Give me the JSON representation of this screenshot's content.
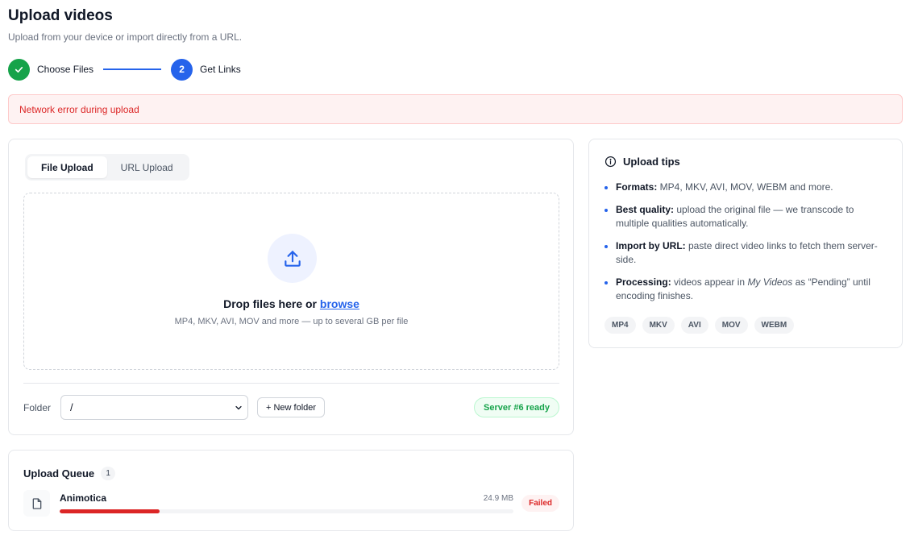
{
  "header": {
    "title": "Upload videos",
    "subtitle": "Upload from your device or import directly from a URL."
  },
  "stepper": {
    "steps": [
      {
        "label": "Choose Files",
        "state": "done",
        "icon": "check-icon"
      },
      {
        "label": "Get Links",
        "number": "2",
        "state": "active"
      }
    ]
  },
  "error": {
    "message": "Network error during upload"
  },
  "upload": {
    "tabs": [
      {
        "label": "File Upload",
        "active": true
      },
      {
        "label": "URL Upload",
        "active": false
      }
    ],
    "dropzone": {
      "icon": "upload-icon",
      "title_prefix": "Drop files here or ",
      "browse_link": "browse",
      "subtitle": "MP4, MKV, AVI, MOV and more — up to several GB per file"
    },
    "folder_label": "Folder",
    "folder_value": "/",
    "new_folder_label": "+ New folder",
    "server_status": "Server #6 ready"
  },
  "tips": {
    "title": "Upload tips",
    "icon": "info-icon",
    "items": {
      "formats": {
        "label": "Formats:",
        "text": " MP4, MKV, AVI, MOV, WEBM and more."
      },
      "quality": {
        "label": "Best quality:",
        "text": " upload the original file — we transcode to multiple qualities automatically."
      },
      "import": {
        "label": "Import by URL:",
        "text": " paste direct video links to fetch them server-side."
      },
      "processing": {
        "label": "Processing:",
        "text_before": " videos appear in ",
        "emphasis": "My Videos",
        "text_after": " as “Pending” until encoding finishes."
      }
    },
    "format_chips": [
      "MP4",
      "MKV",
      "AVI",
      "MOV",
      "WEBM"
    ]
  },
  "queue": {
    "title": "Upload Queue",
    "count": "1",
    "items": [
      {
        "name": "Animotica",
        "size": "24.9 MB",
        "status": "Failed",
        "progress": 0.22,
        "icon": "file-icon"
      }
    ]
  },
  "colors": {
    "primary": "#2563eb",
    "success": "#16a34a",
    "danger": "#dc2626"
  }
}
